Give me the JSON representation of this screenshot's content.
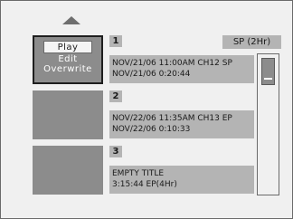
{
  "menu": {
    "items": [
      "Play",
      "Edit",
      "Overwrite"
    ],
    "selected": "Play"
  },
  "mode": "SP (2Hr)",
  "titles": [
    {
      "number": "1",
      "line1": "NOV/21/06  11:00AM CH12  SP",
      "line2": "NOV/21/06    0:20:44"
    },
    {
      "number": "2",
      "line1": "NOV/22/06  11:35AM CH13  EP",
      "line2": "NOV/22/06    0:10:33"
    },
    {
      "number": "3",
      "line1": "EMPTY TITLE",
      "line2": "3:15:44  EP(4Hr)"
    }
  ],
  "colors": {
    "background": "#f0f0f0",
    "panel": "#b4b4b4",
    "thumbnail": "#8c8c8c",
    "text": "#1a1a1a"
  },
  "icons": {
    "scroll_up": "triangle-up-icon"
  }
}
